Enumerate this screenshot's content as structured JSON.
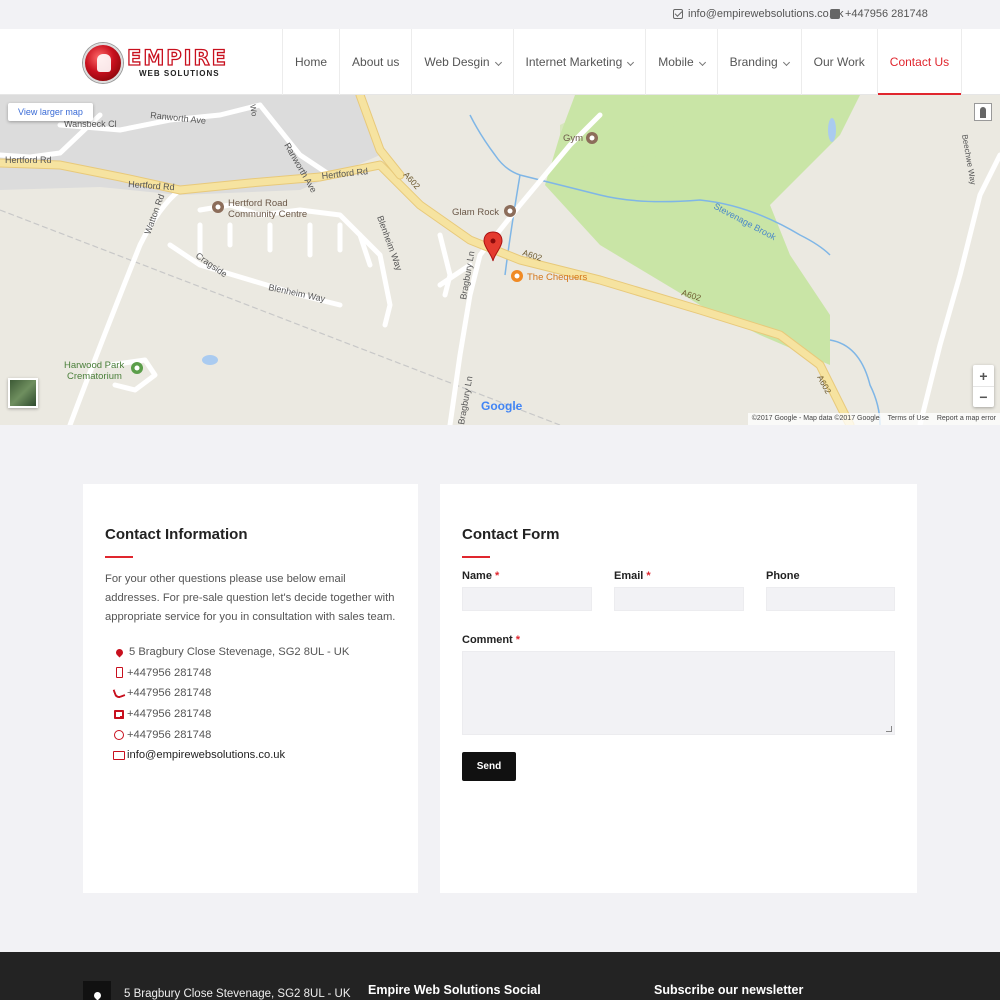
{
  "topbar": {
    "email": "info@empirewebsolutions.co.uk",
    "phone": "+447956 281748"
  },
  "logo": {
    "name": "EMPIRE",
    "tagline": "WEB SOLUTIONS"
  },
  "nav": {
    "items": [
      {
        "label": "Home",
        "dropdown": false
      },
      {
        "label": "About us",
        "dropdown": false
      },
      {
        "label": "Web Desgin",
        "dropdown": true
      },
      {
        "label": "Internet Marketing",
        "dropdown": true
      },
      {
        "label": "Mobile",
        "dropdown": true
      },
      {
        "label": "Branding",
        "dropdown": true
      },
      {
        "label": "Our Work",
        "dropdown": false
      },
      {
        "label": "Contact Us",
        "dropdown": false,
        "active": true
      }
    ]
  },
  "map": {
    "larger_map_label": "View larger map",
    "zoom_in": "+",
    "zoom_out": "−",
    "footer": {
      "data": "©2017 Google - Map data ©2017 Google",
      "terms": "Terms of Use",
      "report": "Report a map error"
    },
    "logo": "Google",
    "labels": {
      "wansbeck": "Wansbeck Cl",
      "ranworth_ave": "Ranworth Ave",
      "ranworth_ave2": "Ranworth Ave",
      "hertford_rd_w": "Hertford Rd",
      "hertford_rd": "Hertford Rd",
      "hertford_rd2": "Hertford Rd",
      "community_1": "Hertford Road",
      "community_2": "Community Centre",
      "watton_rd": "Watton Rd",
      "cragside": "Cragside",
      "blenheim_way": "Blenheim Way",
      "blenheim_way2": "Blenheim Way",
      "bragbury_ln": "Bragbury Ln",
      "bragbury_ln2": "Bragbury Ln",
      "harwood_1": "Harwood Park",
      "harwood_2": "Crematorium",
      "gym": "Gym",
      "glam_rock": "Glam Rock",
      "chequers": "The Chequers",
      "stevenage_brook": "Stevenage Brook",
      "a602_1": "A602",
      "a602_2": "A602",
      "a602_3": "A602",
      "a602_4": "A602",
      "beechwe": "Beechwe Way",
      "wo": "Wo"
    }
  },
  "contact_info": {
    "title": "Contact Information",
    "intro": "For your other questions please use below email addresses. For pre-sale question let's decide together with appropriate service for you in consultation with sales team.",
    "address": "5 Bragbury Close Stevenage, SG2 8UL - UK",
    "mobile": "+447956 281748",
    "phone": "+447956 281748",
    "fax": "+447956 281748",
    "whatsapp": "+447956 281748",
    "email": "info@empirewebsolutions.co.uk"
  },
  "contact_form": {
    "title": "Contact Form",
    "name_label": "Name",
    "email_label": "Email",
    "phone_label": "Phone",
    "comment_label": "Comment",
    "required_mark": "*",
    "name_value": "",
    "email_value": "",
    "phone_value": "",
    "comment_value": "",
    "send_label": "Send"
  },
  "footer": {
    "address": "5 Bragbury Close Stevenage, SG2 8UL - UK",
    "social_title": "Empire Web Solutions Social",
    "newsletter_title": "Subscribe our newsletter"
  },
  "colors": {
    "accent": "#e0262e",
    "park": "#c9e5a6",
    "road_major": "#f6e3a0",
    "water": "#7fb6e6",
    "footer_bg": "#232323"
  },
  "icons": [
    "envelope-icon",
    "phone-icon",
    "map-pin-icon",
    "mobile-icon",
    "fax-icon",
    "whatsapp-icon",
    "chevron-down-icon",
    "pegman-icon"
  ]
}
